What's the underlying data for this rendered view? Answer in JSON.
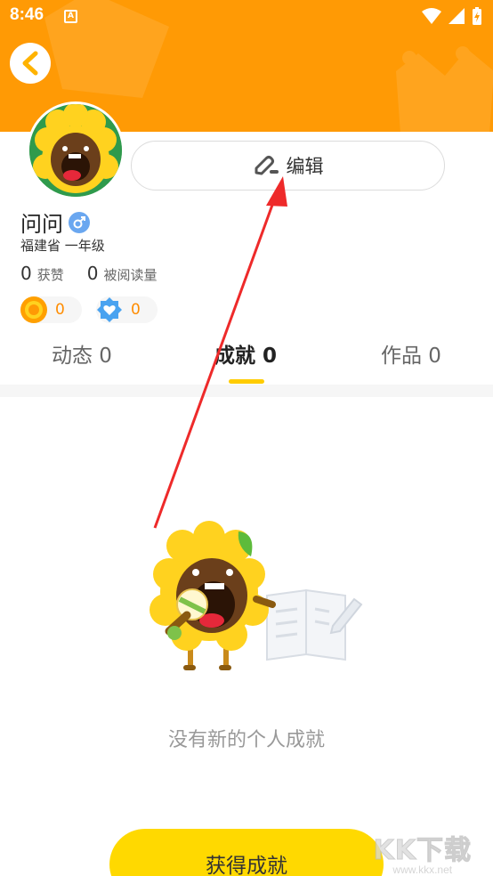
{
  "status_bar": {
    "time": "8:46",
    "notification_glyph": "A"
  },
  "header": {
    "back_icon": "chevron-left-icon"
  },
  "profile": {
    "edit_label": "编辑",
    "name": "问问",
    "gender": "male",
    "meta": "福建省 一年级",
    "likes_count": "0",
    "likes_label": "获赞",
    "reads_count": "0",
    "reads_label": "被阅读量",
    "sun_coins": "0",
    "heart_badges": "0"
  },
  "tabs": [
    {
      "label": "动态 0",
      "active": false
    },
    {
      "label": "成就 0",
      "active": true
    },
    {
      "label": "作品 0",
      "active": false
    }
  ],
  "empty_state": {
    "message": "没有新的个人成就"
  },
  "cta": {
    "label": "获得成就"
  },
  "watermark": {
    "logo": "KK下载",
    "url": "www.kkx.net"
  },
  "colors": {
    "header": "#ff9a05",
    "accent_yellow": "#ffd900",
    "tab_indicator": "#ffcc00",
    "annotation_red": "#ee2a2a"
  }
}
